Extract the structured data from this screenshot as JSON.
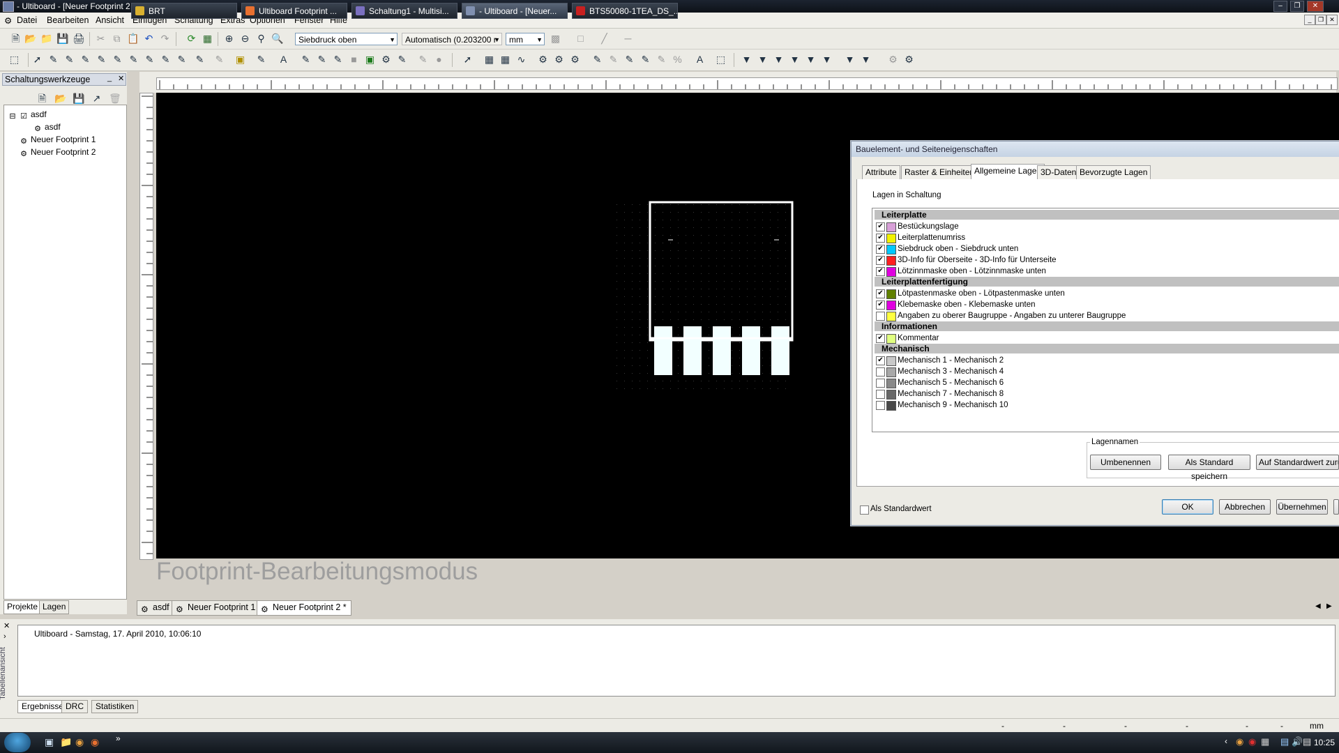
{
  "window": {
    "title": "- Ultiboard - [Neuer Footprint 2 *]"
  },
  "menubar": {
    "items": [
      "Datei",
      "Bearbeiten",
      "Ansicht",
      "Einfügen",
      "Schaltung",
      "Extras",
      "Optionen",
      "Fenster",
      "Hilfe"
    ]
  },
  "toolbar": {
    "layer_combo": "Siebdruck oben",
    "grid_combo": "Automatisch (0.203200 r",
    "unit_combo": "mm"
  },
  "left_panel": {
    "title": "Schaltungswerkzeuge",
    "tree": [
      {
        "label": "asdf",
        "indent": 0
      },
      {
        "label": "asdf",
        "indent": 1
      },
      {
        "label": "Neuer Footprint 1",
        "indent": 0
      },
      {
        "label": "Neuer Footprint 2",
        "indent": 0
      }
    ],
    "tabs": [
      "Projekte",
      "Lagen"
    ]
  },
  "canvas": {
    "mode_label": "Footprint-Bearbeitungsmodus"
  },
  "doc_tabs": [
    "asdf",
    "Neuer Footprint 1",
    "Neuer Footprint 2 *"
  ],
  "output": {
    "vertical_label": "Tabellenansicht",
    "log_line": "Ultiboard  -  Samstag, 17. April 2010, 10:06:10",
    "tabs": [
      "Ergebnisse",
      "DRC",
      "Statistiken"
    ]
  },
  "statusbar": {
    "cells": [
      "-",
      "-",
      "-",
      "-",
      "-",
      "-",
      "mm"
    ]
  },
  "dialog": {
    "title": "Bauelement- und Seiteneigenschaften",
    "tabs": [
      "Attribute",
      "Raster & Einheiten",
      "Allgemeine Lagen",
      "3D-Daten",
      "Bevorzugte Lagen"
    ],
    "active_tab": "Allgemeine Lagen",
    "section_label": "Lagen in Schaltung",
    "groups": [
      {
        "name": "Leiterplatte",
        "layers": [
          {
            "name": "Bestückungslage",
            "checked": true,
            "color": "#d8a0d8"
          },
          {
            "name": "Leiterplattenumriss",
            "checked": true,
            "color": "#f2f200"
          },
          {
            "name": "Siebdruck oben - Siebdruck unten",
            "checked": true,
            "color": "#00c8ff"
          },
          {
            "name": "3D-Info für Oberseite - 3D-Info für Unterseite",
            "checked": true,
            "color": "#ff2020"
          },
          {
            "name": "Lötzinnmaske oben - Lötzinnmaske unten",
            "checked": true,
            "color": "#e000e0"
          }
        ]
      },
      {
        "name": "Leiterplattenfertigung",
        "layers": [
          {
            "name": "Lötpastenmaske oben - Lötpastenmaske unten",
            "checked": true,
            "color": "#608000"
          },
          {
            "name": "Klebemaske oben - Klebemaske unten",
            "checked": true,
            "color": "#e000e0"
          },
          {
            "name": "Angaben zu oberer Baugruppe - Angaben zu unterer Baugruppe",
            "checked": false,
            "color": "#ffff40"
          }
        ]
      },
      {
        "name": "Informationen",
        "layers": [
          {
            "name": "Kommentar",
            "checked": true,
            "color": "#e0ff80"
          }
        ]
      },
      {
        "name": "Mechanisch",
        "layers": [
          {
            "name": "Mechanisch 1 - Mechanisch 2",
            "checked": true,
            "color": "#c8c8c8"
          },
          {
            "name": "Mechanisch 3 - Mechanisch 4",
            "checked": false,
            "color": "#a8a8a8"
          },
          {
            "name": "Mechanisch 5 - Mechanisch 6",
            "checked": false,
            "color": "#888888"
          },
          {
            "name": "Mechanisch 7 - Mechanisch 8",
            "checked": false,
            "color": "#686868"
          },
          {
            "name": "Mechanisch 9 - Mechanisch 10",
            "checked": false,
            "color": "#484848"
          }
        ]
      }
    ],
    "layer_names_group": "Lagennamen",
    "buttons": {
      "rename": "Umbenennen",
      "save_default": "Als Standard speichern",
      "reset_default": "Auf Standardwert zurüc",
      "ok": "OK",
      "cancel": "Abbrechen",
      "apply": "Übernehmen"
    },
    "as_default_label": "Als Standardwert"
  },
  "taskbar": {
    "tasks": [
      "BRT",
      "Ultiboard Footprint ...",
      "Schaltung1 - Multisi...",
      "- Ultiboard - [Neuer...",
      "BTS50080-1TEA_DS_..."
    ],
    "clock": "10:25"
  }
}
